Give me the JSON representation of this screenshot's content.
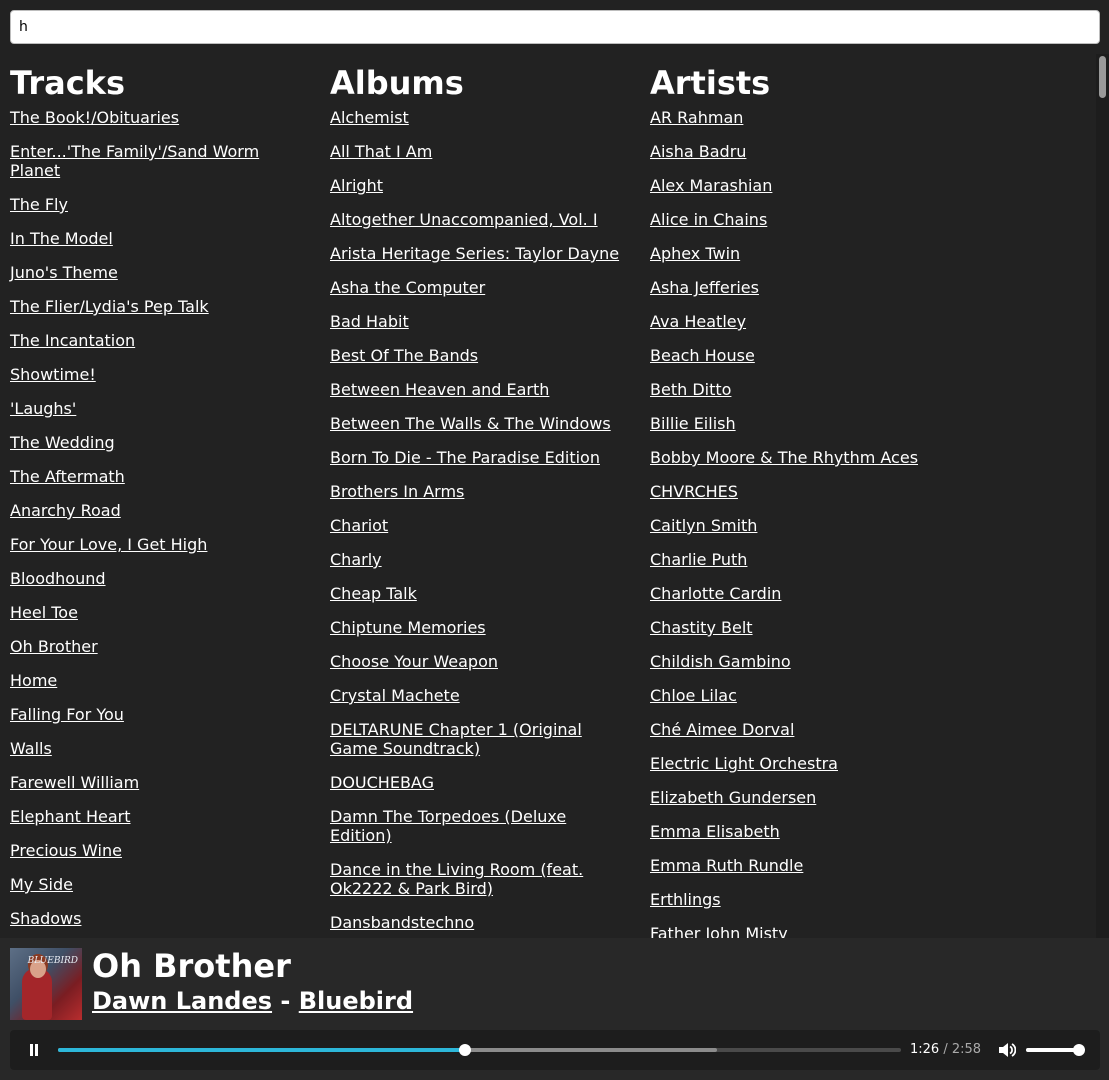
{
  "search": {
    "value": "h",
    "placeholder": ""
  },
  "tracks": {
    "heading": "Tracks",
    "items": [
      "The Book!/Obituaries",
      "Enter...'The Family'/Sand Worm Planet",
      "The Fly",
      "In The Model",
      "Juno's Theme",
      "The Flier/Lydia's Pep Talk",
      "The Incantation",
      "Showtime!",
      "'Laughs'",
      "The Wedding",
      "The Aftermath",
      "Anarchy Road",
      "For Your Love, I Get High",
      "Bloodhound",
      "Heel Toe",
      "Oh Brother",
      "Home",
      "Falling For You",
      "Walls",
      "Farewell William",
      "Elephant Heart",
      "Precious Wine",
      "My Side",
      "Shadows"
    ]
  },
  "albums": {
    "heading": "Albums",
    "items": [
      "Alchemist",
      "All That I Am",
      "Alright",
      "Altogether Unaccompanied, Vol. I",
      "Arista Heritage Series: Taylor Dayne",
      "Asha the Computer",
      "Bad Habit",
      "Best Of The Bands",
      "Between Heaven and Earth",
      "Between The Walls & The Windows",
      "Born To Die - The Paradise Edition",
      "Brothers In Arms",
      "Chariot",
      "Charly",
      "Cheap Talk",
      "Chiptune Memories",
      "Choose Your Weapon",
      "Crystal Machete",
      "DELTARUNE Chapter 1 (Original Game Soundtrack)",
      "DOUCHEBAG",
      "Damn The Torpedoes (Deluxe Edition)",
      "Dance in the Living Room (feat. Ok2222 & Park Bird)",
      "Dansbandstechno"
    ]
  },
  "artists": {
    "heading": "Artists",
    "items": [
      "AR Rahman",
      "Aisha Badru",
      "Alex Marashian",
      "Alice in Chains",
      "Aphex Twin",
      "Asha Jefferies",
      "Ava Heatley",
      "Beach House",
      "Beth Ditto",
      "Billie Eilish",
      "Bobby Moore & The Rhythm Aces",
      "CHVRCHES",
      "Caitlyn Smith",
      "Charlie Puth",
      "Charlotte Cardin",
      "Chastity Belt",
      "Childish Gambino",
      "Chloe Lilac",
      "Ché Aimee Dorval",
      "Electric Light Orchestra",
      "Elizabeth Gundersen",
      "Emma Elisabeth",
      "Emma Ruth Rundle",
      "Erthlings",
      "Father John Misty"
    ]
  },
  "now_playing": {
    "title": "Oh Brother",
    "artist": "Dawn Landes",
    "separator": "-",
    "album": "Bluebird",
    "cover_text": "BLUEBIRD"
  },
  "player": {
    "current_time": "1:26",
    "time_separator": "/",
    "duration": "2:58",
    "progress": 0.483,
    "buffered": 0.782,
    "volume": 1.0,
    "accent_color": "#2db7d9"
  }
}
